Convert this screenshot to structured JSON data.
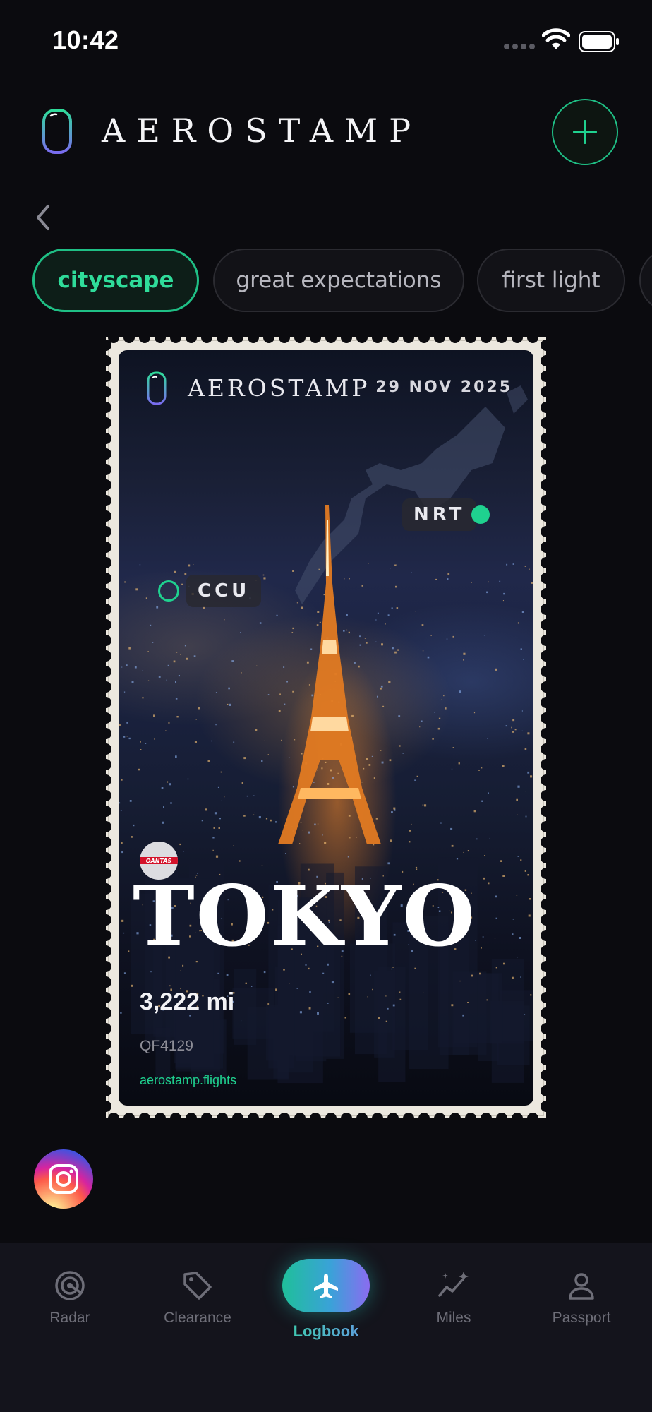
{
  "status_bar": {
    "time": "10:42"
  },
  "header": {
    "title": "AEROSTAMP"
  },
  "chips": [
    {
      "label": "cityscape",
      "active": true
    },
    {
      "label": "great expectations",
      "active": false
    },
    {
      "label": "first light",
      "active": false
    }
  ],
  "stamp": {
    "brand": "AEROSTAMP",
    "date": "29 NOV 2025",
    "destination_code": "NRT",
    "origin_code": "CCU",
    "airline_logo_text": "QANTAS",
    "city": "TOKYO",
    "distance": "3,222 mi",
    "flight_number": "QF4129",
    "website": "aerostamp.flights"
  },
  "nav": {
    "items": [
      {
        "label": "Radar",
        "icon": "radar-icon"
      },
      {
        "label": "Clearance",
        "icon": "tag-icon"
      },
      {
        "label": "Logbook",
        "icon": "plane-icon",
        "active": true
      },
      {
        "label": "Miles",
        "icon": "sparkle-chart-icon"
      },
      {
        "label": "Passport",
        "icon": "person-icon"
      }
    ]
  },
  "colors": {
    "accent": "#1fbf85",
    "background": "#0b0b0f",
    "nav_background": "#14141c"
  }
}
